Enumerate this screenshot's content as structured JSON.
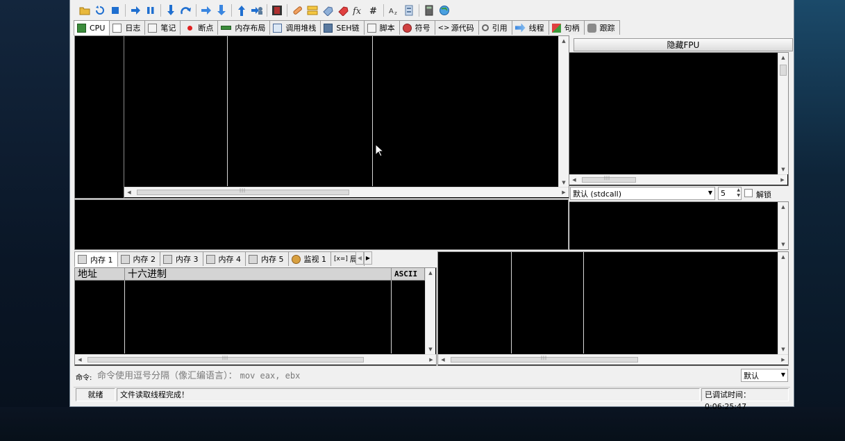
{
  "tabs": [
    {
      "label": "CPU",
      "icon": "cpu-icon",
      "active": true
    },
    {
      "label": "日志",
      "icon": "log-icon"
    },
    {
      "label": "笔记",
      "icon": "notes-icon"
    },
    {
      "label": "断点",
      "icon": "breakpoint-icon"
    },
    {
      "label": "内存布局",
      "icon": "memory-map-icon"
    },
    {
      "label": "调用堆栈",
      "icon": "call-stack-icon"
    },
    {
      "label": "SEH链",
      "icon": "seh-icon"
    },
    {
      "label": "脚本",
      "icon": "script-icon"
    },
    {
      "label": "符号",
      "icon": "symbol-icon"
    },
    {
      "label": "源代码",
      "icon": "source-icon"
    },
    {
      "label": "引用",
      "icon": "references-icon"
    },
    {
      "label": "线程",
      "icon": "threads-icon"
    },
    {
      "label": "句柄",
      "icon": "handles-icon"
    },
    {
      "label": "跟踪",
      "icon": "trace-icon"
    }
  ],
  "fpu": {
    "hide_label": "隐藏FPU"
  },
  "calling_convention": {
    "selected": "默认 (stdcall)",
    "count": "5",
    "unlock_label": "解锁"
  },
  "dump_tabs": [
    {
      "label": "内存 1",
      "active": true
    },
    {
      "label": "内存 2"
    },
    {
      "label": "内存 3"
    },
    {
      "label": "内存 4"
    },
    {
      "label": "内存 5"
    },
    {
      "label": "监视 1"
    },
    {
      "label": "局",
      "prefix": "[x=]"
    }
  ],
  "dump_columns": {
    "address": "地址",
    "hex": "十六进制",
    "ascii": "ASCII"
  },
  "command": {
    "label": "命令:",
    "placeholder_cn": "命令使用逗号分隔（像汇编语言）：",
    "placeholder_code": "mov eax, ebx",
    "mode": "默认"
  },
  "status": {
    "state": "就绪",
    "message": "文件读取线程完成！",
    "time_label": "已调试时间：",
    "time_value": "0:06:25:47"
  },
  "colors": {
    "panel_bg": "#000000",
    "chrome": "#f0f0f0",
    "accent_blue": "#1f6fd0"
  }
}
